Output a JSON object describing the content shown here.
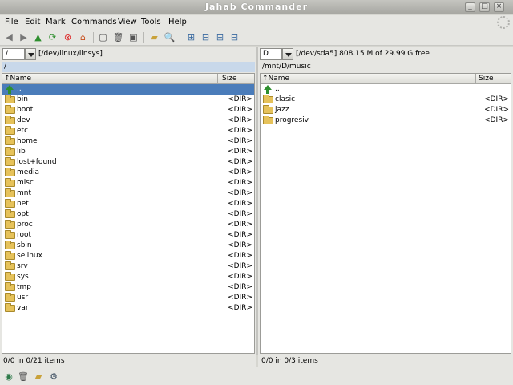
{
  "window": {
    "title": "Jahab Commander"
  },
  "menu": [
    "File",
    "Edit",
    "Mark",
    "Commands",
    "View",
    "Tools",
    "Help"
  ],
  "left_panel": {
    "drive": "/",
    "drive_info": "[/dev/linux/linsys]",
    "path": "/",
    "columns": {
      "name": "Name",
      "size": "Size"
    },
    "rows": [
      {
        "name": "..",
        "size": "",
        "type": "up"
      },
      {
        "name": "bin",
        "size": "<DIR>",
        "type": "dir"
      },
      {
        "name": "boot",
        "size": "<DIR>",
        "type": "dir"
      },
      {
        "name": "dev",
        "size": "<DIR>",
        "type": "dir"
      },
      {
        "name": "etc",
        "size": "<DIR>",
        "type": "dir"
      },
      {
        "name": "home",
        "size": "<DIR>",
        "type": "dir"
      },
      {
        "name": "lib",
        "size": "<DIR>",
        "type": "dir"
      },
      {
        "name": "lost+found",
        "size": "<DIR>",
        "type": "dir"
      },
      {
        "name": "media",
        "size": "<DIR>",
        "type": "dir"
      },
      {
        "name": "misc",
        "size": "<DIR>",
        "type": "dir"
      },
      {
        "name": "mnt",
        "size": "<DIR>",
        "type": "dir"
      },
      {
        "name": "net",
        "size": "<DIR>",
        "type": "dir"
      },
      {
        "name": "opt",
        "size": "<DIR>",
        "type": "dir"
      },
      {
        "name": "proc",
        "size": "<DIR>",
        "type": "dir"
      },
      {
        "name": "root",
        "size": "<DIR>",
        "type": "dir"
      },
      {
        "name": "sbin",
        "size": "<DIR>",
        "type": "dir"
      },
      {
        "name": "selinux",
        "size": "<DIR>",
        "type": "dir"
      },
      {
        "name": "srv",
        "size": "<DIR>",
        "type": "dir"
      },
      {
        "name": "sys",
        "size": "<DIR>",
        "type": "dir"
      },
      {
        "name": "tmp",
        "size": "<DIR>",
        "type": "dir"
      },
      {
        "name": "usr",
        "size": "<DIR>",
        "type": "dir"
      },
      {
        "name": "var",
        "size": "<DIR>",
        "type": "dir"
      }
    ],
    "status": "0/0 in 0/21 items"
  },
  "right_panel": {
    "drive": "D",
    "drive_info": "[/dev/sda5]  808.15 M of 29.99 G free",
    "path": "/mnt/D/music",
    "columns": {
      "name": "Name",
      "size": "Size"
    },
    "rows": [
      {
        "name": "..",
        "size": "",
        "type": "up"
      },
      {
        "name": "clasic",
        "size": "<DIR>",
        "type": "dir"
      },
      {
        "name": "jazz",
        "size": "<DIR>",
        "type": "dir"
      },
      {
        "name": "progresiv",
        "size": "<DIR>",
        "type": "dir"
      }
    ],
    "status": "0/0 in 0/3 items"
  },
  "colors": {
    "selection": "#4a7cba",
    "active_path": "#c8d8ea",
    "folder": "#e6c25a"
  }
}
